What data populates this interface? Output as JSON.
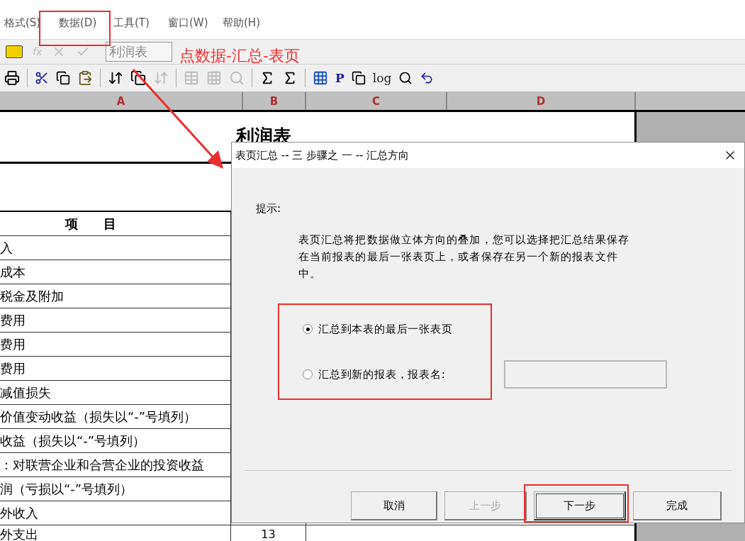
{
  "menu": [
    "格式(S)",
    "数据(D)",
    "工具(T)",
    "窗口(W)",
    "帮助(H)"
  ],
  "formula_bar": {
    "fx": "fx",
    "value": "利润表"
  },
  "toolbar": {
    "p_button": "P",
    "log_button": "log"
  },
  "columns": [
    "A",
    "B",
    "C",
    "D"
  ],
  "sheet": {
    "title": "利润表",
    "header": "项　　目",
    "rows": [
      {
        "item": "入"
      },
      {
        "item": "成本"
      },
      {
        "item": "税金及附加"
      },
      {
        "item": "费用"
      },
      {
        "item": "费用"
      },
      {
        "item": "费用"
      },
      {
        "item": "减值损失"
      },
      {
        "item": "价值变动收益（损失以“-”号填列）"
      },
      {
        "item": "收益（损失以“-”号填列）"
      },
      {
        "item": "：对联营企业和合营企业的投资收益"
      },
      {
        "item": "润（亏损以“-”号填列）"
      },
      {
        "item": "外收入"
      },
      {
        "item": "外支出",
        "number": "13"
      }
    ]
  },
  "annotation": {
    "text": "点数据-汇总-表页"
  },
  "dialog": {
    "title": "表页汇总 -- 三 步骤之 一 -- 汇总方向",
    "prompt_label": "提示:",
    "description": "表页汇总将把数据做立体方向的叠加，您可以选择把汇总结果保存在当前报表的最后一张表页上，或者保存在另一个新的报表文件中。",
    "options": [
      {
        "label": "汇总到本表的最后一张表页",
        "selected": true
      },
      {
        "label": "汇总到新的报表，报表名:",
        "selected": false
      }
    ],
    "name_field": {
      "disabled": true
    },
    "buttons": [
      {
        "label": "取消",
        "disabled": false,
        "default": false
      },
      {
        "label": "上一步",
        "disabled": true,
        "default": false
      },
      {
        "label": "下一步",
        "disabled": false,
        "default": true
      },
      {
        "label": "完成",
        "disabled": false,
        "default": false
      }
    ]
  }
}
